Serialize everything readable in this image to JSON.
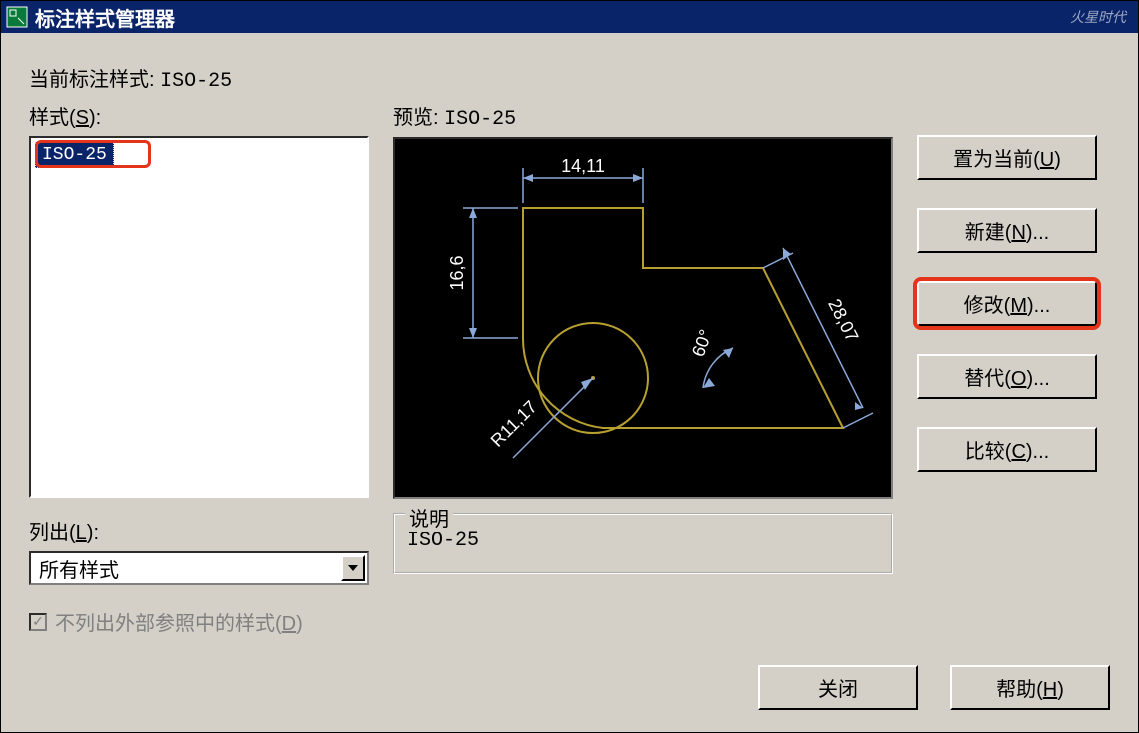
{
  "window": {
    "title": "标注样式管理器",
    "watermark": "火星时代"
  },
  "current_style": {
    "label": "当前标注样式: ",
    "value": "ISO-25"
  },
  "styles": {
    "label": "样式(S):",
    "items": [
      "ISO-25"
    ]
  },
  "preview": {
    "label": "预览: ",
    "value": "ISO-25",
    "dims": {
      "top": "14,11",
      "left": "16,6",
      "radius": "R11,17",
      "angle": "60°",
      "diag": "28,07"
    }
  },
  "buttons": {
    "set_current": "置为当前(U)",
    "new": "新建(N)...",
    "modify": "修改(M)...",
    "override": "替代(O)...",
    "compare": "比较(C)...",
    "close": "关闭",
    "help": "帮助(H)"
  },
  "list_filter": {
    "label": "列出(L):",
    "selected": "所有样式"
  },
  "checkbox": {
    "label": "不列出外部参照中的样式(D)",
    "checked": true
  },
  "description": {
    "legend": "说明",
    "text": "ISO-25"
  }
}
